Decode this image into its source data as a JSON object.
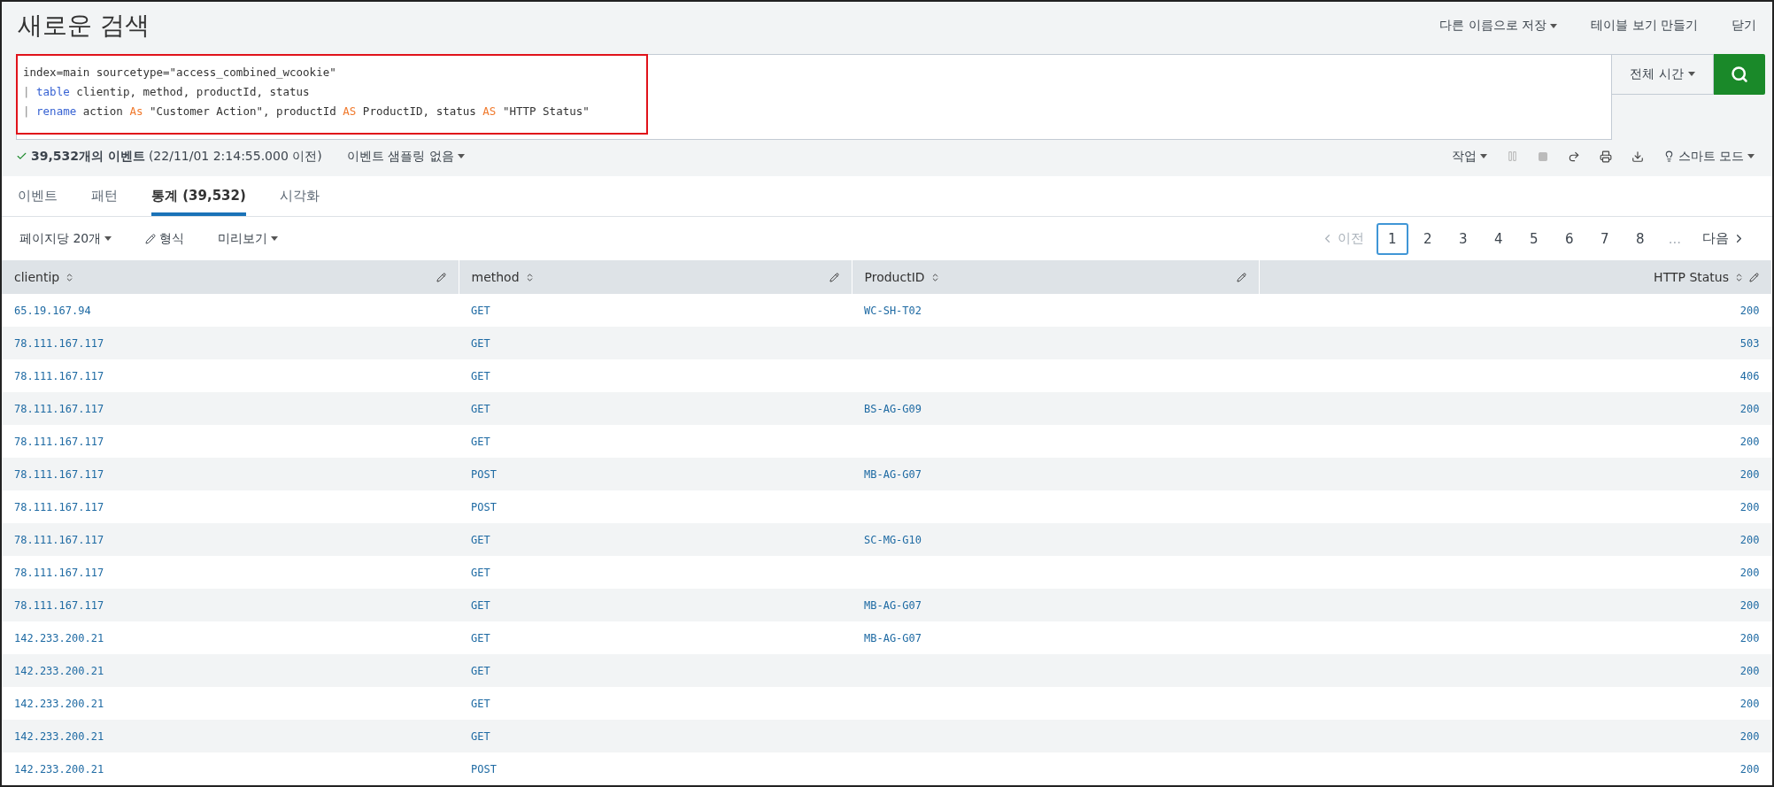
{
  "title": "새로운 검색",
  "header_actions": [
    {
      "label": "다른 이름으로 저장",
      "dropdown": true
    },
    {
      "label": "테이블 보기 만들기",
      "dropdown": false
    },
    {
      "label": "닫기",
      "dropdown": false
    }
  ],
  "query": [
    [
      {
        "text": "index=main sourcetype=\"access_combined_wcookie\"",
        "kind": "plain"
      }
    ],
    [
      {
        "text": "| ",
        "kind": "pipe"
      },
      {
        "text": "table",
        "kind": "command"
      },
      {
        "text": " clientip, method, productId, status",
        "kind": "plain"
      }
    ],
    [
      {
        "text": "| ",
        "kind": "pipe"
      },
      {
        "text": "rename",
        "kind": "command"
      },
      {
        "text": " action ",
        "kind": "plain"
      },
      {
        "text": "As",
        "kind": "keyword"
      },
      {
        "text": " \"Customer Action\", productId ",
        "kind": "plain"
      },
      {
        "text": "AS",
        "kind": "keyword"
      },
      {
        "text": " ProductID, status ",
        "kind": "plain"
      },
      {
        "text": "AS",
        "kind": "keyword"
      },
      {
        "text": " \"HTTP Status\"",
        "kind": "plain"
      }
    ]
  ],
  "time_range": "전체 시간",
  "status": {
    "count": "39,532개의 이벤트",
    "time": "(22/11/01 2:14:55.000 이전)",
    "sampling": "이벤트 샘플링 없음"
  },
  "job_menu": "작업",
  "mode": "스마트 모드",
  "tabs": [
    {
      "label": "이벤트",
      "selected": false
    },
    {
      "label": "패턴",
      "selected": false
    },
    {
      "label": "통계 (39,532)",
      "selected": true
    },
    {
      "label": "시각화",
      "selected": false
    }
  ],
  "controls": {
    "per_page": "페이지당 20개",
    "format": "형식",
    "preview": "미리보기"
  },
  "pagination": {
    "prev": "이전",
    "next": "다음",
    "pages": [
      {
        "label": "1",
        "selected": true
      },
      {
        "label": "2",
        "selected": false
      },
      {
        "label": "3",
        "selected": false
      },
      {
        "label": "4",
        "selected": false
      },
      {
        "label": "5",
        "selected": false
      },
      {
        "label": "6",
        "selected": false
      },
      {
        "label": "7",
        "selected": false
      },
      {
        "label": "8",
        "selected": false
      }
    ],
    "ellipsis": "..."
  },
  "columns": [
    {
      "label": "clientip",
      "kind": "text"
    },
    {
      "label": "method",
      "kind": "text"
    },
    {
      "label": "ProductID",
      "kind": "text"
    },
    {
      "label": "HTTP Status",
      "kind": "numeric"
    }
  ],
  "rows": [
    [
      "65.19.167.94",
      "GET",
      "WC-SH-T02",
      "200"
    ],
    [
      "78.111.167.117",
      "GET",
      "",
      "503"
    ],
    [
      "78.111.167.117",
      "GET",
      "",
      "406"
    ],
    [
      "78.111.167.117",
      "GET",
      "BS-AG-G09",
      "200"
    ],
    [
      "78.111.167.117",
      "GET",
      "",
      "200"
    ],
    [
      "78.111.167.117",
      "POST",
      "MB-AG-G07",
      "200"
    ],
    [
      "78.111.167.117",
      "POST",
      "",
      "200"
    ],
    [
      "78.111.167.117",
      "GET",
      "SC-MG-G10",
      "200"
    ],
    [
      "78.111.167.117",
      "GET",
      "",
      "200"
    ],
    [
      "78.111.167.117",
      "GET",
      "MB-AG-G07",
      "200"
    ],
    [
      "142.233.200.21",
      "GET",
      "MB-AG-G07",
      "200"
    ],
    [
      "142.233.200.21",
      "GET",
      "",
      "200"
    ],
    [
      "142.233.200.21",
      "GET",
      "",
      "200"
    ],
    [
      "142.233.200.21",
      "GET",
      "",
      "200"
    ],
    [
      "142.233.200.21",
      "POST",
      "",
      "200"
    ]
  ]
}
